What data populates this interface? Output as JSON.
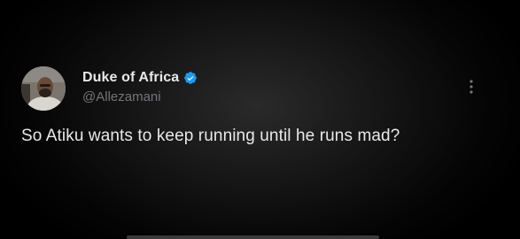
{
  "tweet": {
    "author": {
      "display_name": "Duke of Africa",
      "handle": "@Allezamani",
      "verified": true,
      "avatar_icon": "profile-photo"
    },
    "text": "So Atiku wants to keep running until he runs mad?",
    "more_icon": "more-options-icon"
  },
  "colors": {
    "background": "#000000",
    "text_primary": "#e7e9ea",
    "text_secondary": "#71767b",
    "verified_badge": "#1d9bf0"
  }
}
